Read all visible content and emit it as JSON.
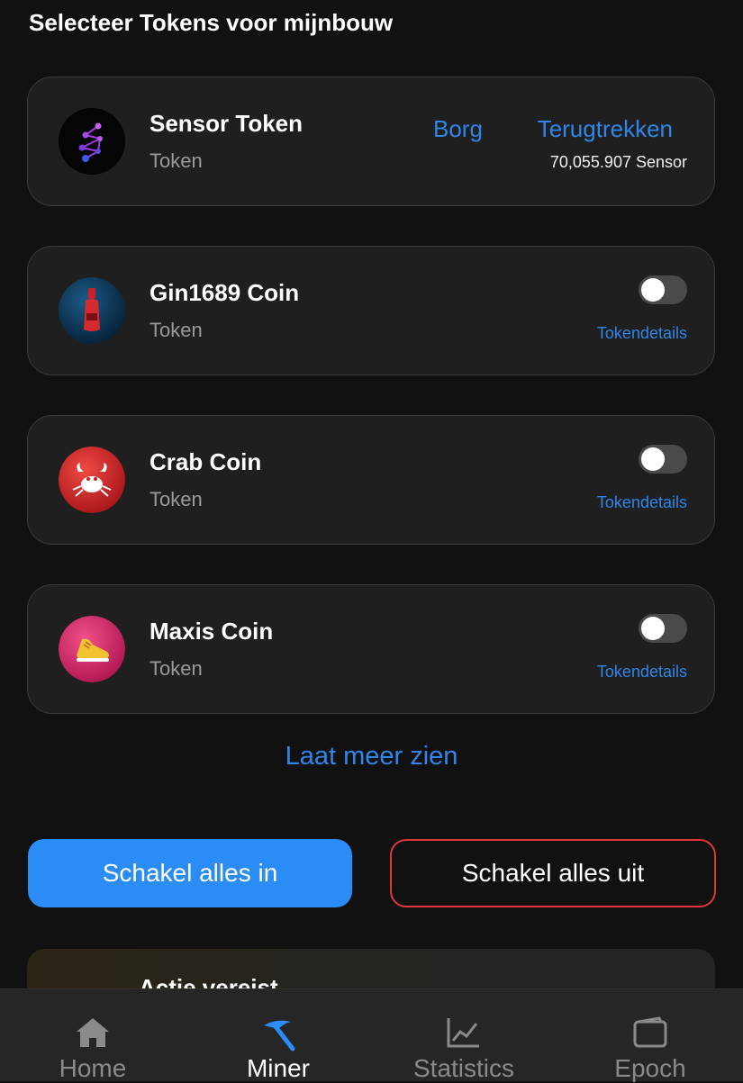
{
  "header": {
    "title": "Selecteer Tokens voor mijnbouw"
  },
  "sensor": {
    "name": "Sensor Token",
    "type": "Token",
    "borg_label": "Borg",
    "withdraw_label": "Terugtrekken",
    "balance": "70,055.907 Sensor"
  },
  "tokens": [
    {
      "name": "Gin1689 Coin",
      "type": "Token",
      "details_label": "Tokendetails",
      "enabled": false,
      "logo_color": "#0e3a5c"
    },
    {
      "name": "Crab Coin",
      "type": "Token",
      "details_label": "Tokendetails",
      "enabled": false,
      "logo_color": "#d32a2a"
    },
    {
      "name": "Maxis Coin",
      "type": "Token",
      "details_label": "Tokendetails",
      "enabled": false,
      "logo_color": "#e0336e"
    }
  ],
  "show_more": "Laat meer zien",
  "actions": {
    "enable_all": "Schakel alles in",
    "disable_all": "Schakel alles uit"
  },
  "notice": {
    "title": "Actie vereist"
  },
  "tabbar": {
    "items": [
      {
        "label": "Home",
        "icon": "home-icon",
        "active": false
      },
      {
        "label": "Miner",
        "icon": "pickaxe-icon",
        "active": true
      },
      {
        "label": "Statistics",
        "icon": "chart-icon",
        "active": false
      },
      {
        "label": "Epoch",
        "icon": "wallet-icon",
        "active": false
      }
    ]
  },
  "colors": {
    "accent": "#2c8cf6",
    "danger": "#e0383a",
    "background": "#111111",
    "card": "#1f1f1f"
  }
}
